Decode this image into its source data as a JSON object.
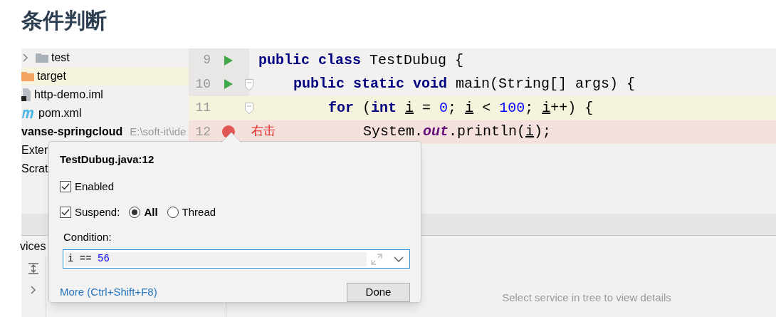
{
  "heading": "条件判断",
  "tree": [
    {
      "label": "test",
      "kind": "collapsed-folder",
      "selected": false
    },
    {
      "label": "target",
      "kind": "excluded-folder",
      "selected": true
    },
    {
      "label": "http-demo.iml",
      "kind": "file",
      "selected": false
    },
    {
      "label": "pom.xml",
      "kind": "maven",
      "selected": false
    },
    {
      "label": "vanse-springcloud",
      "path": "E:\\soft-it\\ide",
      "kind": "module",
      "selected": false
    },
    {
      "label": "Exter",
      "kind": "plain",
      "selected": false
    },
    {
      "label": "Scrat",
      "kind": "plain",
      "selected": false
    }
  ],
  "editor": {
    "lines": [
      {
        "number": "9",
        "run": true,
        "fold": false,
        "breakpoint": false,
        "kind": "plain",
        "tokens": [
          {
            "text": "public class ",
            "kind": "keyword"
          },
          {
            "text": "TestDubug",
            "kind": "plain"
          },
          {
            "text": " {",
            "kind": "plain"
          }
        ],
        "children": [
          {
            "number": "10",
            "run": true,
            "fold": true,
            "breakpoint": false,
            "kind": "plain",
            "tokens": [
              {
                "text": "public static void ",
                "kind": "keyword"
              },
              {
                "text": "main(String[] args) {",
                "kind": "plain"
              }
            ],
            "children": [
              {
                "number": "11",
                "run": false,
                "fold": true,
                "breakpoint": false,
                "kind": "caret",
                "tokens": [
                  {
                    "text": "for ",
                    "kind": "keyword"
                  },
                  {
                    "text": "(",
                    "kind": "plain"
                  },
                  {
                    "text": "int ",
                    "kind": "keyword"
                  },
                  {
                    "text": "i",
                    "kind": "var"
                  },
                  {
                    "text": " = ",
                    "kind": "plain"
                  },
                  {
                    "text": "0",
                    "kind": "number"
                  },
                  {
                    "text": "; ",
                    "kind": "plain"
                  },
                  {
                    "text": "i",
                    "kind": "var"
                  },
                  {
                    "text": " < ",
                    "kind": "plain"
                  },
                  {
                    "text": "100",
                    "kind": "number"
                  },
                  {
                    "text": "; ",
                    "kind": "plain"
                  },
                  {
                    "text": "i",
                    "kind": "var"
                  },
                  {
                    "text": "++) {",
                    "kind": "plain"
                  }
                ],
                "children": [
                  {
                    "number": "12",
                    "run": false,
                    "fold": false,
                    "breakpoint": true,
                    "kind": "breakpoint",
                    "annotation": "右击",
                    "tokens": [
                      {
                        "text": "System.",
                        "kind": "plain"
                      },
                      {
                        "text": "out",
                        "kind": "field"
                      },
                      {
                        "text": ".println(",
                        "kind": "plain"
                      },
                      {
                        "text": "i",
                        "kind": "var"
                      },
                      {
                        "text": ");",
                        "kind": "plain"
                      }
                    ]
                  }
                ]
              }
            ]
          }
        ]
      }
    ]
  },
  "breakpoint_popup": {
    "title": "TestDubug.java:12",
    "enabled": {
      "label": "Enabled",
      "checked": true
    },
    "suspend": {
      "label": "Suspend:",
      "checked": true
    },
    "suspend_options": [
      {
        "label": "All",
        "selected": true
      },
      {
        "label": "Thread",
        "selected": false
      }
    ],
    "condition_label": "Condition:",
    "condition": [
      {
        "text": "i == ",
        "kind": "plain"
      },
      {
        "text": "56",
        "kind": "number"
      }
    ],
    "more_link": "More (Ctrl+Shift+F8)",
    "done_button": "Done"
  },
  "services": {
    "title": "vices",
    "empty_text": "Select service in tree to view details"
  }
}
